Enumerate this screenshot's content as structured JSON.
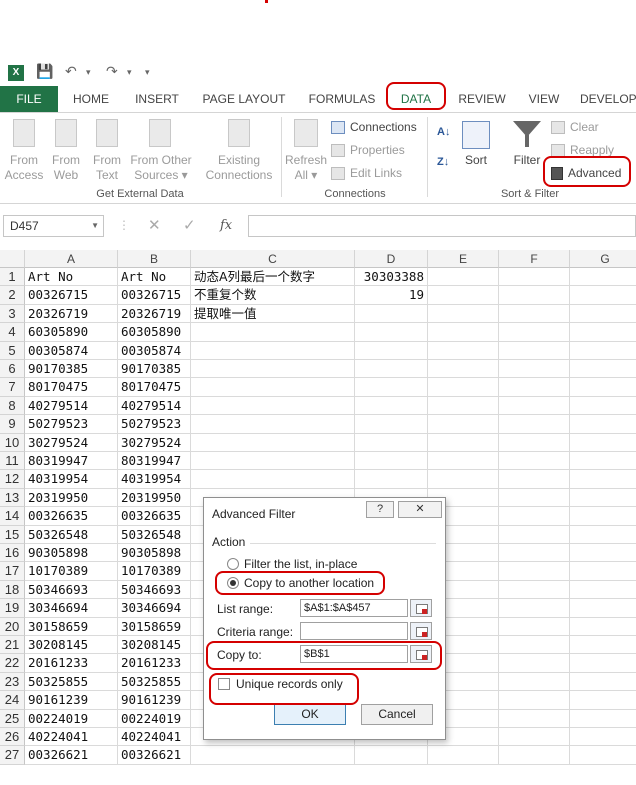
{
  "qat": {
    "logo": "X",
    "save": "💾",
    "undo": "↶",
    "undo_dd": "▾",
    "redo": "↷",
    "redo_dd": "▾",
    "more": "▾"
  },
  "tabs": [
    "FILE",
    "HOME",
    "INSERT",
    "PAGE LAYOUT",
    "FORMULAS",
    "DATA",
    "REVIEW",
    "VIEW",
    "DEVELOP"
  ],
  "active_tab": "DATA",
  "ribbon": {
    "get_external": {
      "from_access": [
        "From",
        "Access"
      ],
      "from_web": [
        "From",
        "Web"
      ],
      "from_text": [
        "From",
        "Text"
      ],
      "from_other": [
        "From Other",
        "Sources ▾"
      ],
      "existing": [
        "Existing",
        "Connections"
      ],
      "label": "Get External Data"
    },
    "connections": {
      "refresh": [
        "Refresh",
        "All ▾"
      ],
      "connections": "Connections",
      "properties": "Properties",
      "edit_links": "Edit Links",
      "label": "Connections"
    },
    "sort_filter": {
      "sort": "Sort",
      "filter": "Filter",
      "clear": "Clear",
      "reapply": "Reapply",
      "advanced": "Advanced",
      "label": "Sort & Filter"
    }
  },
  "formula_bar": {
    "name_box": "D457",
    "cancel": "✕",
    "enter": "✓",
    "fx": "fx",
    "formula": ""
  },
  "columns": [
    "A",
    "B",
    "C",
    "D",
    "E",
    "F",
    "G"
  ],
  "rows": [
    {
      "n": "1",
      "a": "Art No",
      "b": "Art No",
      "c": "动态A列最后一个数字",
      "d": "30303388"
    },
    {
      "n": "2",
      "a": "00326715",
      "b": "00326715",
      "c": "不重复个数",
      "d": "19"
    },
    {
      "n": "3",
      "a": "20326719",
      "b": "20326719",
      "c": "提取唯一值",
      "d": ""
    },
    {
      "n": "4",
      "a": "60305890",
      "b": "60305890",
      "c": "",
      "d": ""
    },
    {
      "n": "5",
      "a": "00305874",
      "b": "00305874",
      "c": "",
      "d": ""
    },
    {
      "n": "6",
      "a": "90170385",
      "b": "90170385",
      "c": "",
      "d": ""
    },
    {
      "n": "7",
      "a": "80170475",
      "b": "80170475",
      "c": "",
      "d": ""
    },
    {
      "n": "8",
      "a": "40279514",
      "b": "40279514",
      "c": "",
      "d": ""
    },
    {
      "n": "9",
      "a": "50279523",
      "b": "50279523",
      "c": "",
      "d": ""
    },
    {
      "n": "10",
      "a": "30279524",
      "b": "30279524",
      "c": "",
      "d": ""
    },
    {
      "n": "11",
      "a": "80319947",
      "b": "80319947",
      "c": "",
      "d": ""
    },
    {
      "n": "12",
      "a": "40319954",
      "b": "40319954",
      "c": "",
      "d": ""
    },
    {
      "n": "13",
      "a": "20319950",
      "b": "20319950",
      "c": "",
      "d": ""
    },
    {
      "n": "14",
      "a": "00326635",
      "b": "00326635",
      "c": "",
      "d": ""
    },
    {
      "n": "15",
      "a": "50326548",
      "b": "50326548",
      "c": "",
      "d": ""
    },
    {
      "n": "16",
      "a": "90305898",
      "b": "90305898",
      "c": "",
      "d": ""
    },
    {
      "n": "17",
      "a": "10170389",
      "b": "10170389",
      "c": "",
      "d": ""
    },
    {
      "n": "18",
      "a": "50346693",
      "b": "50346693",
      "c": "",
      "d": ""
    },
    {
      "n": "19",
      "a": "30346694",
      "b": "30346694",
      "c": "",
      "d": ""
    },
    {
      "n": "20",
      "a": "30158659",
      "b": "30158659",
      "c": "",
      "d": ""
    },
    {
      "n": "21",
      "a": "30208145",
      "b": "30208145",
      "c": "",
      "d": ""
    },
    {
      "n": "22",
      "a": "20161233",
      "b": "20161233",
      "c": "",
      "d": ""
    },
    {
      "n": "23",
      "a": "50325855",
      "b": "50325855",
      "c": "",
      "d": ""
    },
    {
      "n": "24",
      "a": "90161239",
      "b": "90161239",
      "c": "",
      "d": ""
    },
    {
      "n": "25",
      "a": "00224019",
      "b": "00224019",
      "c": "",
      "d": ""
    },
    {
      "n": "26",
      "a": "40224041",
      "b": "40224041",
      "c": "",
      "d": ""
    },
    {
      "n": "27",
      "a": "00326621",
      "b": "00326621",
      "c": "",
      "d": ""
    }
  ],
  "dialog": {
    "title": "Advanced Filter",
    "help": "?",
    "close": "✕",
    "action_label": "Action",
    "opt_inplace": "Filter the list, in-place",
    "opt_copy": "Copy to another location",
    "selected": "copy",
    "list_range_label": "List range:",
    "list_range": "$A$1:$A$457",
    "criteria_label": "Criteria range:",
    "criteria_range": "",
    "copy_to_label": "Copy to:",
    "copy_to": "$B$1",
    "unique_label": "Unique records only",
    "unique_checked": false,
    "ok": "OK",
    "cancel": "Cancel"
  },
  "annotation_color": "#d40000"
}
